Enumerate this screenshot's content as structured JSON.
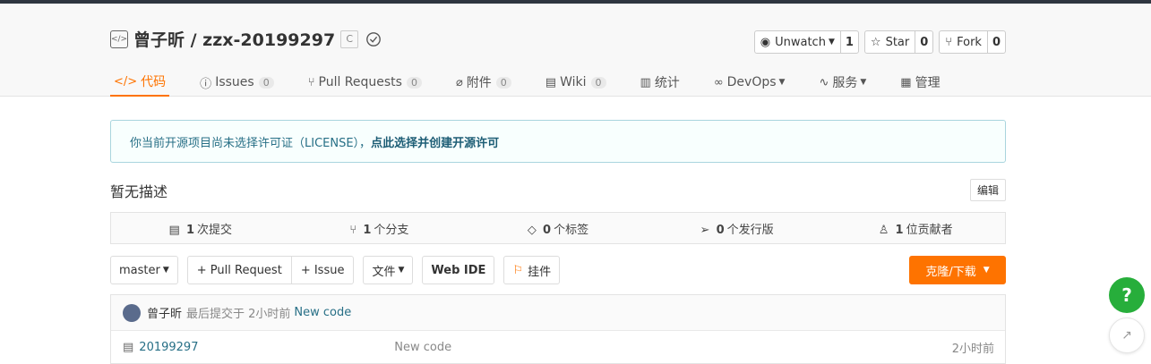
{
  "repo": {
    "title": "曾子昕 / zzx-20199297",
    "lang_badge": "C"
  },
  "actions": {
    "watch_label": "Unwatch",
    "watch_count": "1",
    "star_label": "Star",
    "star_count": "0",
    "fork_label": "Fork",
    "fork_count": "0"
  },
  "tabs": [
    {
      "label": "代码",
      "count": null
    },
    {
      "label": "Issues",
      "count": "0"
    },
    {
      "label": "Pull Requests",
      "count": "0"
    },
    {
      "label": "附件",
      "count": "0"
    },
    {
      "label": "Wiki",
      "count": "0"
    },
    {
      "label": "统计",
      "count": null
    },
    {
      "label": "DevOps",
      "count": null
    },
    {
      "label": "服务",
      "count": null
    },
    {
      "label": "管理",
      "count": null
    }
  ],
  "license": {
    "text": "你当前开源项目尚未选择许可证（LICENSE），",
    "link": "点此选择并创建开源许可"
  },
  "description": {
    "text": "暂无描述",
    "edit": "编辑"
  },
  "stats": {
    "commits_num": "1",
    "commits_label": "次提交",
    "branches_num": "1",
    "branches_label": "个分支",
    "tags_num": "0",
    "tags_label": "个标签",
    "releases_num": "0",
    "releases_label": "个发行版",
    "contributors_num": "1",
    "contributors_label": "位贡献者"
  },
  "toolbar": {
    "branch": "master",
    "pull_request": "+ Pull Request",
    "issue": "+ Issue",
    "files": "文件",
    "webide": "Web IDE",
    "widget": "挂件",
    "clone": "克隆/下载"
  },
  "commit": {
    "author": "曾子昕",
    "meta": "最后提交于 2小时前",
    "message": "New code"
  },
  "files": [
    {
      "name": "20199297",
      "message": "New code",
      "time": "2小时前"
    }
  ],
  "colors": {
    "accent": "#fe7300",
    "help": "#27ae3b",
    "link": "#276f86"
  }
}
